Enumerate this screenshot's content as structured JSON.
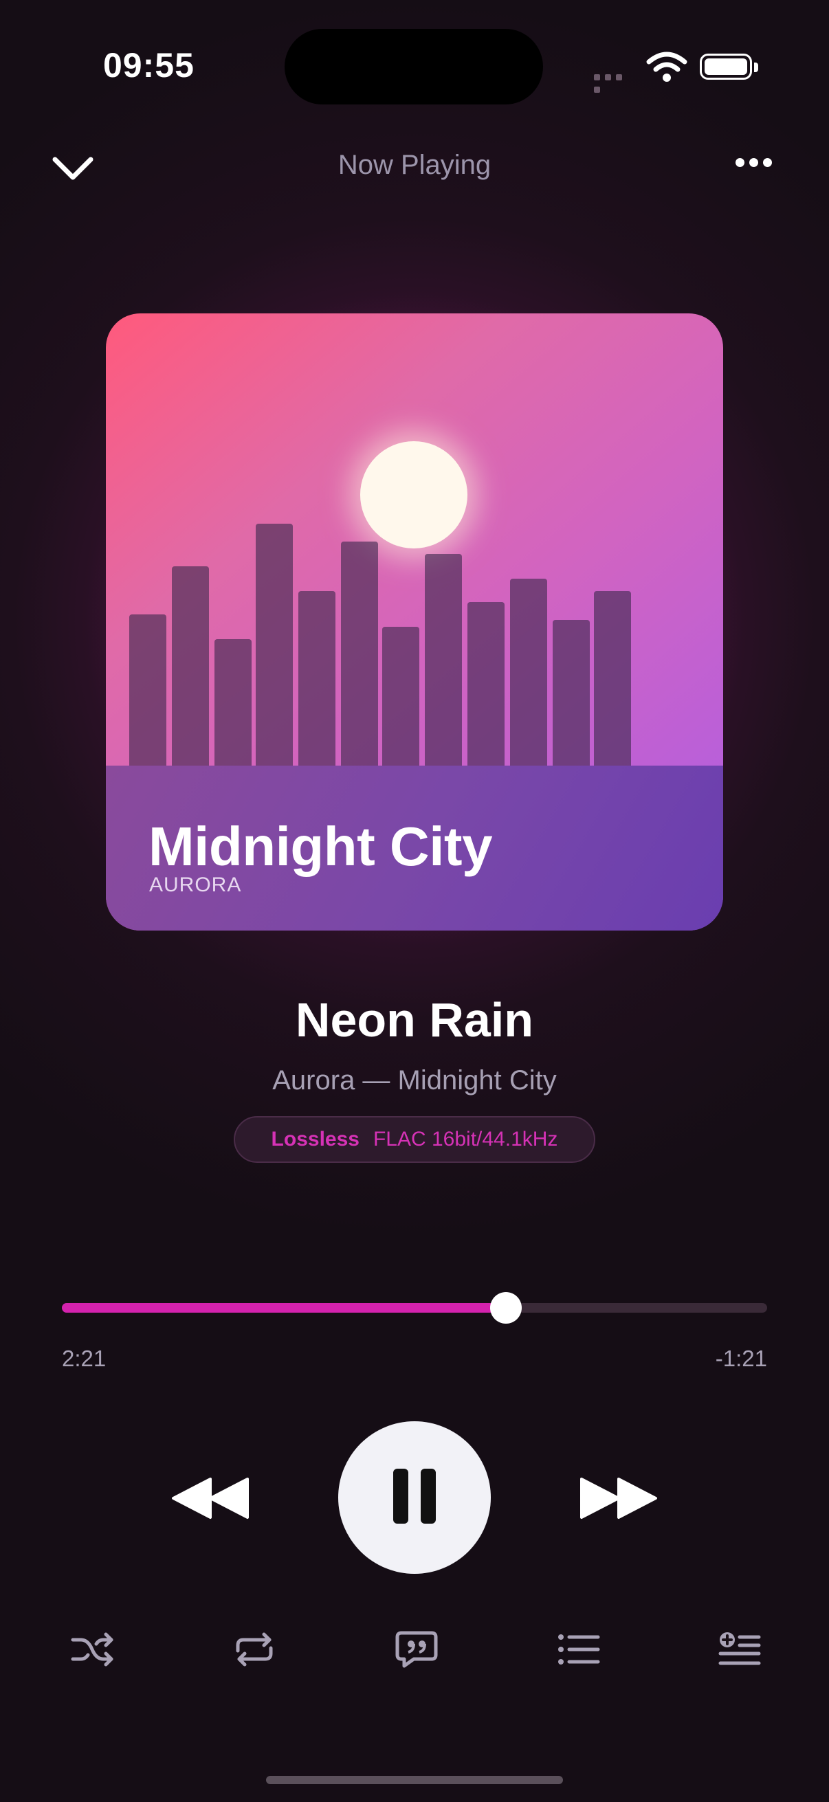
{
  "status_bar": {
    "time": "09:55"
  },
  "header": {
    "title": "Now Playing"
  },
  "album_art": {
    "title": "Midnight City",
    "artist": "AURORA"
  },
  "track": {
    "title": "Neon Rain",
    "subtitle": "Aurora — Midnight City",
    "badge": {
      "label": "Lossless",
      "format": "FLAC 16bit/44.1kHz"
    }
  },
  "playback": {
    "elapsed": "2:21",
    "remaining": "-1:21",
    "progress_fraction": 0.63
  },
  "controls": [
    "rewind-icon",
    "pause-icon",
    "fast-forward-icon"
  ],
  "toolbar": [
    "shuffle-icon",
    "repeat-icon",
    "lyrics-icon",
    "queue-icon",
    "add-to-queue-icon"
  ],
  "colors": {
    "accent": "#d422ae",
    "background": "#1e0f1c"
  }
}
